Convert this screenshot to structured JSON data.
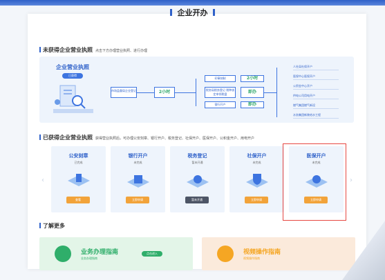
{
  "page": {
    "title": "企业开办"
  },
  "section1": {
    "title": "未获得企业营业执照",
    "subtitle": "点击下方办理营业执照、进行办理"
  },
  "hero": {
    "title": "企业营业执照",
    "badge": "已获得"
  },
  "flow": {
    "register": "市场监督局企业登记",
    "register_time": "2小时",
    "seal": "印章刻制",
    "seal_time": "2小时",
    "tax": "税务局税务登记 税种核定申领税盘",
    "tax_time": "即办",
    "bank": "银行开户",
    "bank_time": "即办"
  },
  "outcomes": [
    "人社局社保开户",
    "医保中心医保开户",
    "公积金中心开户",
    "供电公司用电开户",
    "燃气集团燃气新设",
    "水务集团新装给水工程"
  ],
  "section2": {
    "title": "已获得企业营业执照",
    "subtitle": "获得营业执照后，可办理公安刻章、银行开户、税务登记、社保开户、医保开户、公积金开户、用电开户"
  },
  "services": [
    {
      "name": "公安刻章",
      "status": "已完成",
      "action": "查看",
      "color": "#f2a33a"
    },
    {
      "name": "银行开户",
      "status": "未完成",
      "action": "立即申请",
      "color": "#f2a33a"
    },
    {
      "name": "税务登记",
      "status": "暂未开通",
      "action": "暂未开通",
      "color": "#4d5566"
    },
    {
      "name": "社保开户",
      "status": "未完成",
      "action": "立即申请",
      "color": "#f2a33a"
    },
    {
      "name": "医保开户",
      "status": "未完成",
      "action": "立即申请",
      "color": "#f2a33a"
    }
  ],
  "nav": {
    "prev": "‹",
    "next": "›"
  },
  "section3": {
    "title": "了解更多"
  },
  "guides": {
    "business_title": "业务办理指南",
    "business_sub": "业务办理指南",
    "business_btn": "点击进入",
    "video_title": "视频操作指南",
    "video_sub": "视频操作指南"
  },
  "colors": {
    "primary": "#2f61c9",
    "green": "#31a86c",
    "orange": "#f2a33a",
    "highlight": "#e64640"
  }
}
